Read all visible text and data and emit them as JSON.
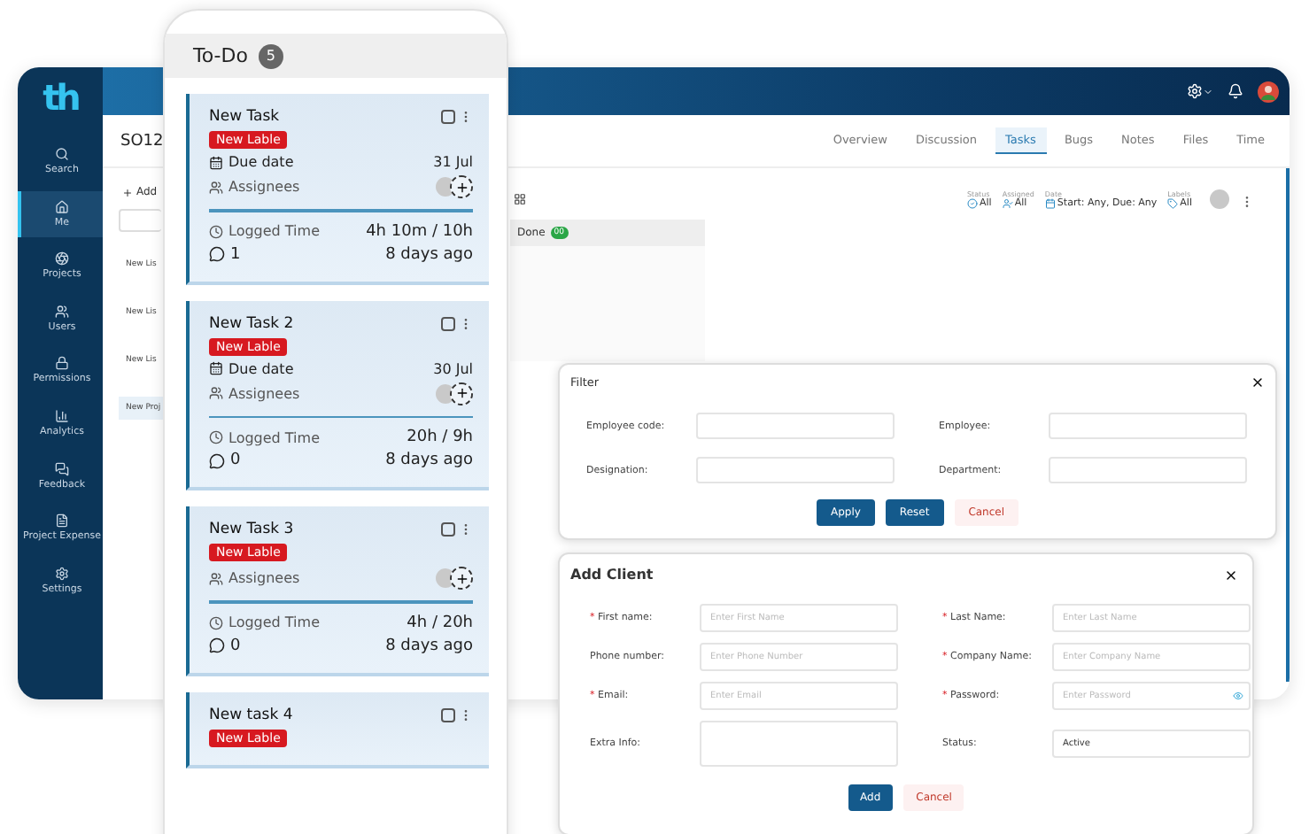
{
  "app": {
    "logo": "th",
    "sidebar": {
      "items": [
        {
          "label": "Search",
          "selected": false
        },
        {
          "label": "Me",
          "selected": true
        },
        {
          "label": "Projects",
          "selected": false
        },
        {
          "label": "Users",
          "selected": false
        },
        {
          "label": "Permissions",
          "selected": false
        },
        {
          "label": "Analytics",
          "selected": false
        },
        {
          "label": "Feedback",
          "selected": false
        },
        {
          "label": "Project Expense",
          "selected": false
        },
        {
          "label": "Settings",
          "selected": false
        }
      ]
    },
    "project_title": "SO12",
    "tabs": [
      {
        "label": "Overview",
        "selected": false
      },
      {
        "label": "Discussion",
        "selected": false
      },
      {
        "label": "Tasks",
        "selected": true
      },
      {
        "label": "Bugs",
        "selected": false
      },
      {
        "label": "Notes",
        "selected": false
      },
      {
        "label": "Files",
        "selected": false
      },
      {
        "label": "Time",
        "selected": false
      }
    ],
    "add_button": "Add",
    "lists": [
      {
        "label": "New Lis",
        "selected": false
      },
      {
        "label": "New Lis",
        "selected": false
      },
      {
        "label": "New Lis",
        "selected": false
      },
      {
        "label": "New Proj",
        "selected": true
      }
    ],
    "filters": [
      {
        "caption": "Status",
        "value": "All"
      },
      {
        "caption": "Assigned",
        "value": "All"
      },
      {
        "caption": "Date",
        "value": "Start: Any, Due: Any"
      },
      {
        "caption": "Labels",
        "value": "All"
      }
    ],
    "column": {
      "title": "Done",
      "count": "00"
    }
  },
  "phone": {
    "column_title": "To-Do",
    "count": "5",
    "cards": [
      {
        "title": "New Task",
        "checked": false,
        "label": "New Lable",
        "due_label": "Due date",
        "due_date": "31 Jul",
        "assignees": "Assignees",
        "logged_label": "Logged Time",
        "logged": "4h 10m / 10h",
        "comments": "1",
        "age": "8 days ago"
      },
      {
        "title": "New Task 2",
        "checked": false,
        "label": "New Lable",
        "due_label": "Due date",
        "due_date": "30 Jul",
        "assignees": "Assignees",
        "logged_label": "Logged Time",
        "logged": "20h / 9h",
        "comments": "0",
        "age": "8 days ago"
      },
      {
        "title": "New Task 3",
        "checked": false,
        "label": "New Lable",
        "assignees": "Assignees",
        "logged_label": "Logged Time",
        "logged": "4h / 20h",
        "comments": "0",
        "age": "8 days ago"
      },
      {
        "title": "New task 4",
        "checked": false,
        "label": "New Lable"
      }
    ]
  },
  "filter_dialog": {
    "title": "Filter",
    "fields": [
      {
        "label": "Employee code:"
      },
      {
        "label": "Employee:"
      },
      {
        "label": "Designation:"
      },
      {
        "label": "Department:"
      }
    ],
    "buttons": [
      {
        "label": "Apply",
        "kind": "primary"
      },
      {
        "label": "Reset",
        "kind": "primary"
      },
      {
        "label": "Cancel",
        "kind": "cancel"
      }
    ]
  },
  "add_client_dialog": {
    "title": "Add Client",
    "fields": [
      {
        "label": "First name:",
        "required_mark": "*",
        "kind": "text",
        "placeholder": "Enter First Name"
      },
      {
        "label": "Last Name:",
        "required_mark": "*",
        "kind": "text",
        "placeholder": "Enter Last Name"
      },
      {
        "label": "Phone number:",
        "kind": "text",
        "placeholder": "Enter Phone Number"
      },
      {
        "label": "Company Name:",
        "required_mark": "*",
        "kind": "text",
        "placeholder": "Enter Company Name"
      },
      {
        "label": "Email:",
        "required_mark": "*",
        "kind": "text",
        "placeholder": "Enter Email"
      },
      {
        "label": "Password:",
        "required_mark": "*",
        "kind": "password",
        "placeholder": "Enter Password"
      },
      {
        "label": "Extra Info:",
        "kind": "textarea"
      },
      {
        "label": "Status:",
        "kind": "text",
        "value": "Active"
      }
    ],
    "buttons": [
      {
        "label": "Add",
        "kind": "primary"
      },
      {
        "label": "Cancel",
        "kind": "cancel"
      }
    ]
  }
}
